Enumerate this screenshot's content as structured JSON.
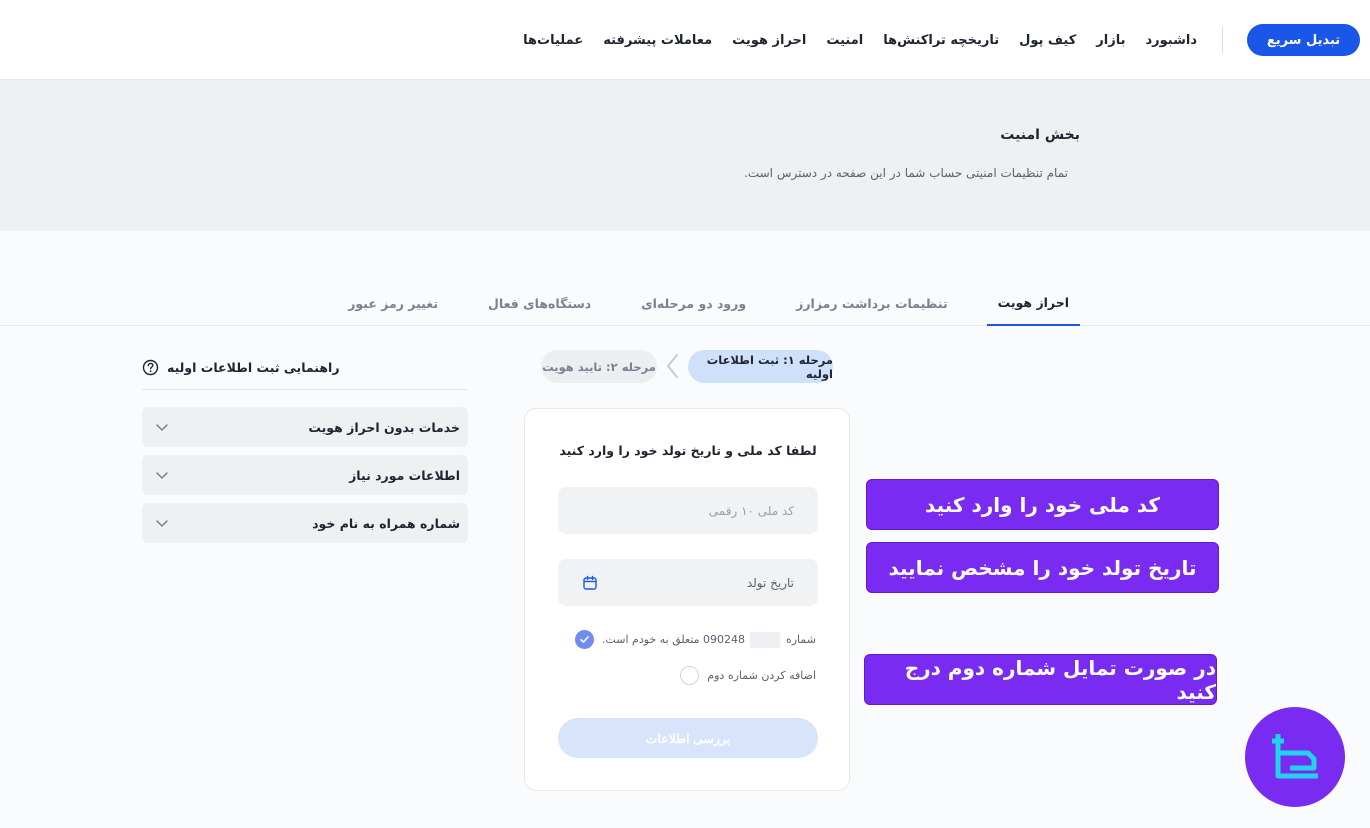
{
  "header": {
    "quick_button": "تبدیل سریع",
    "nav": [
      "داشبورد",
      "بازار",
      "کیف پول",
      "تاریخچه تراکنش‌ها",
      "امنیت",
      "احراز هویت",
      "معاملات پیشرفته",
      "عملیات‌ها"
    ]
  },
  "banner": {
    "title": "بخش امنیت",
    "subtitle": "تمام تنظیمات امنیتی حساب شما در این صفحه در دسترس است."
  },
  "tabs": [
    "احراز هویت",
    "تنظیمات برداشت رمزارز",
    "ورود دو مرحله‌ای",
    "دستگاه‌های فعال",
    "تغییر رمز عبور"
  ],
  "active_tab": "احراز هویت",
  "stepper": {
    "step1": "مرحله ۱: ثبت اطلاعات اولیه",
    "step2": "مرحله ۲: تایید هویت"
  },
  "form": {
    "title": "لطفا کد ملی و تاریخ تولد خود را وارد کنید",
    "national_id_placeholder": "کد ملی ۱۰ رقمی",
    "birthdate_label": "تاریخ تولد",
    "phone_check_prefix": "شماره",
    "phone_check_number": "090248",
    "phone_check_suffix": "متعلق به خودم است.",
    "phone_check_checked": true,
    "second_number_label": "اضافه کردن شماره دوم",
    "second_number_checked": false,
    "submit_label": "بررسی اطلاعات"
  },
  "guide": {
    "title": "راهنمایی ثبت اطلاعات اولیه",
    "items": [
      "خدمات بدون احراز هویت",
      "اطلاعات مورد نیاز",
      "شماره همراه به نام خود"
    ]
  },
  "annotations": {
    "national_id": "کد ملی خود را وارد کنید",
    "birthdate": "تاریخ تولد خود را مشخص نمایید",
    "second_number": "در صورت تمایل شماره دوم درج کنید"
  },
  "colors": {
    "primary": "#1a56e8",
    "annotation": "#7a2bf2",
    "step_active": "#cfe0fb",
    "checkbox_on": "#6f8df0"
  }
}
